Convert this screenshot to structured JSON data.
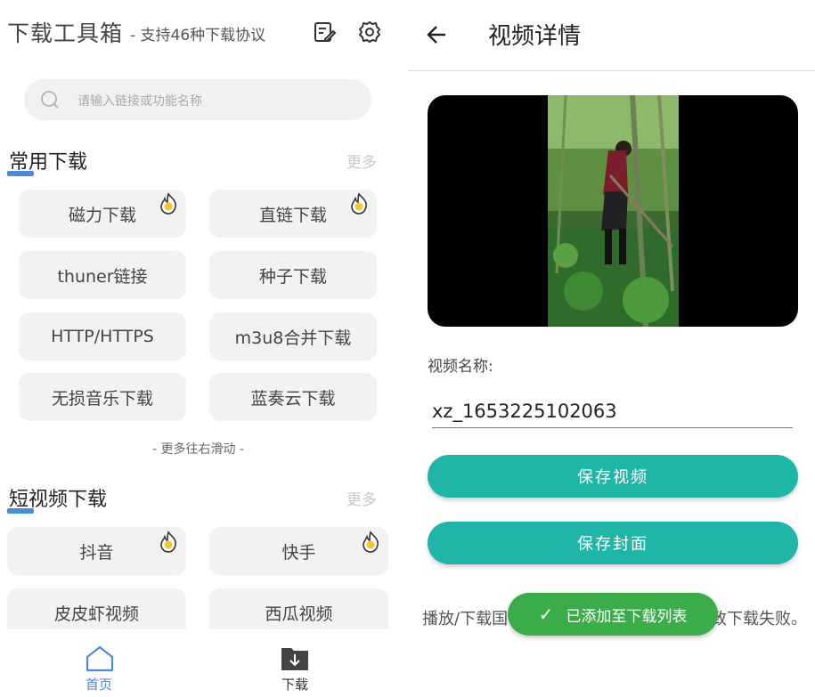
{
  "left": {
    "app_title": "下载工具箱",
    "app_subtitle": "- 支持46种下载协议",
    "search_placeholder": "请输入链接或功能名称",
    "section1": {
      "title": "常用下载",
      "more": "更多",
      "items": [
        {
          "label": "磁力下载",
          "hot": true
        },
        {
          "label": "直链下载",
          "hot": true
        },
        {
          "label": "thuner链接",
          "hot": false
        },
        {
          "label": "种子下载",
          "hot": false
        },
        {
          "label": "HTTP/HTTPS",
          "hot": false
        },
        {
          "label": "m3u8合并下载",
          "hot": false
        },
        {
          "label": "无损音乐下载",
          "hot": false
        },
        {
          "label": "蓝奏云下载",
          "hot": false
        }
      ],
      "scroll_hint": "- 更多往右滑动 -"
    },
    "section2": {
      "title": "短视频下载",
      "more": "更多",
      "items": [
        {
          "label": "抖音",
          "hot": true
        },
        {
          "label": "快手",
          "hot": true
        },
        {
          "label": "皮皮虾视频",
          "hot": false
        },
        {
          "label": "西瓜视频",
          "hot": false
        }
      ]
    },
    "tabbar": {
      "home_label": "首页",
      "download_label": "下载",
      "active_color": "#4a8ad8"
    }
  },
  "right": {
    "page_title": "视频详情",
    "video_name_label": "视频名称:",
    "video_name_value": "xz_1653225102063",
    "save_video_button": "保存视频",
    "save_cover_button": "保存封面",
    "note_left": "播放/下载国",
    "note_right": "致下载失败。",
    "toast": "已添加至下载列表",
    "accent_color": "#20b6a7",
    "toast_color": "#3aad4a"
  }
}
